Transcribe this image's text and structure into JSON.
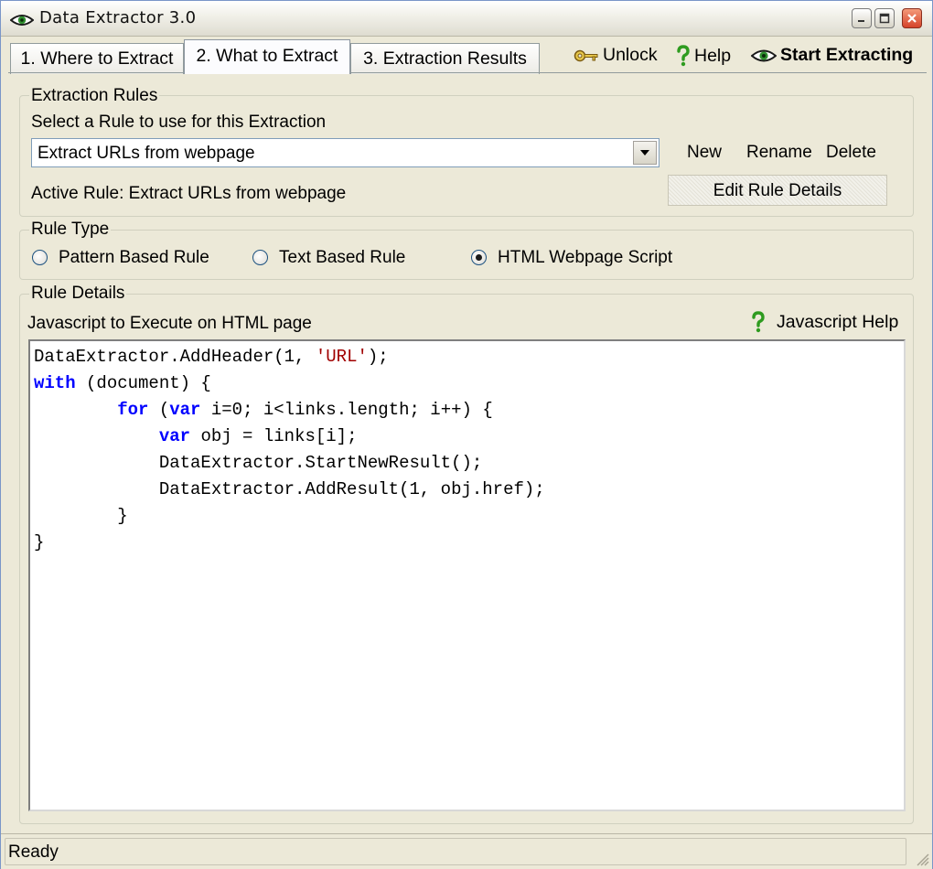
{
  "window": {
    "title": "Data Extractor 3.0"
  },
  "tabs": [
    {
      "label": "1. Where to Extract"
    },
    {
      "label": "2. What to Extract"
    },
    {
      "label": "3. Extraction Results"
    }
  ],
  "toolbar": {
    "unlock": "Unlock",
    "help": "Help",
    "start": "Start Extracting"
  },
  "extraction_rules": {
    "legend": "Extraction Rules",
    "prompt": "Select a Rule to use for this Extraction",
    "selected_rule": "Extract URLs from webpage",
    "new": "New",
    "rename": "Rename",
    "delete": "Delete",
    "active_rule": "Active Rule: Extract URLs from webpage",
    "edit_details": "Edit Rule Details"
  },
  "rule_type": {
    "legend": "Rule Type",
    "options": [
      {
        "label": "Pattern Based Rule",
        "selected": false
      },
      {
        "label": "Text Based Rule",
        "selected": false
      },
      {
        "label": "HTML Webpage Script",
        "selected": true
      }
    ]
  },
  "rule_details": {
    "legend": "Rule Details",
    "editor_label": "Javascript to Execute on HTML page",
    "help": "Javascript Help"
  },
  "code": [
    "DataExtractor.AddHeader(1, 'URL');",
    "with (document) {",
    "        for (var i=0; i<links.length; i++) {",
    "            var obj = links[i];",
    "            DataExtractor.StartNewResult();",
    "            DataExtractor.AddResult(1, obj.href);",
    "        }",
    "}"
  ],
  "status": {
    "text": "Ready"
  },
  "colors": {
    "keyword": "#0000ff",
    "string": "#a00000",
    "help_icon": "#2e9b1f"
  },
  "icons": {
    "app": "eye-icon",
    "unlock": "key-icon",
    "help": "question-mark-icon",
    "start": "eye-icon"
  }
}
